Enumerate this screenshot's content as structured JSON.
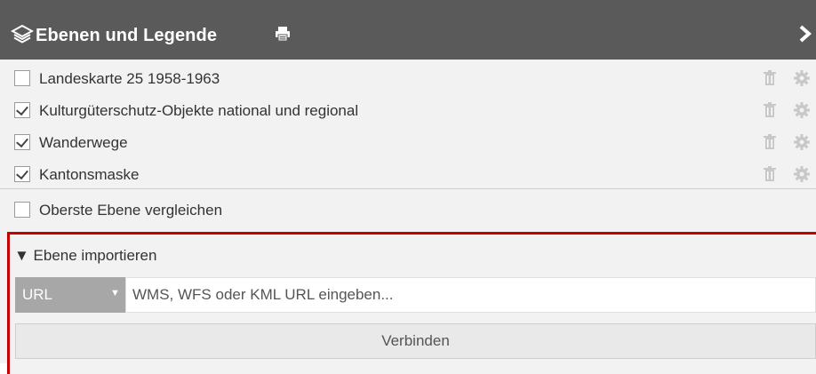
{
  "header": {
    "title": "Ebenen und Legende",
    "icons": [
      "layers-icon",
      "print-icon",
      "chevron-right-icon"
    ]
  },
  "layers": [
    {
      "label": "Landeskarte 25 1958-1963",
      "checked": false
    },
    {
      "label": "Kulturgüterschutz-Objekte national und regional",
      "checked": true
    },
    {
      "label": "Wanderwege",
      "checked": true
    },
    {
      "label": "Kantonsmaske",
      "checked": true
    }
  ],
  "compare": {
    "label": "Oberste Ebene vergleichen",
    "checked": false
  },
  "import": {
    "title": "▼ Ebene importieren",
    "select_value": "URL",
    "input_placeholder": "WMS, WFS oder KML URL eingeben...",
    "connect_label": "Verbinden"
  },
  "colors": {
    "header_bg": "#5a5a5a",
    "panel_bg": "#f2f2f2",
    "highlight_border": "#c40000",
    "select_bg": "#a7a7a7"
  }
}
